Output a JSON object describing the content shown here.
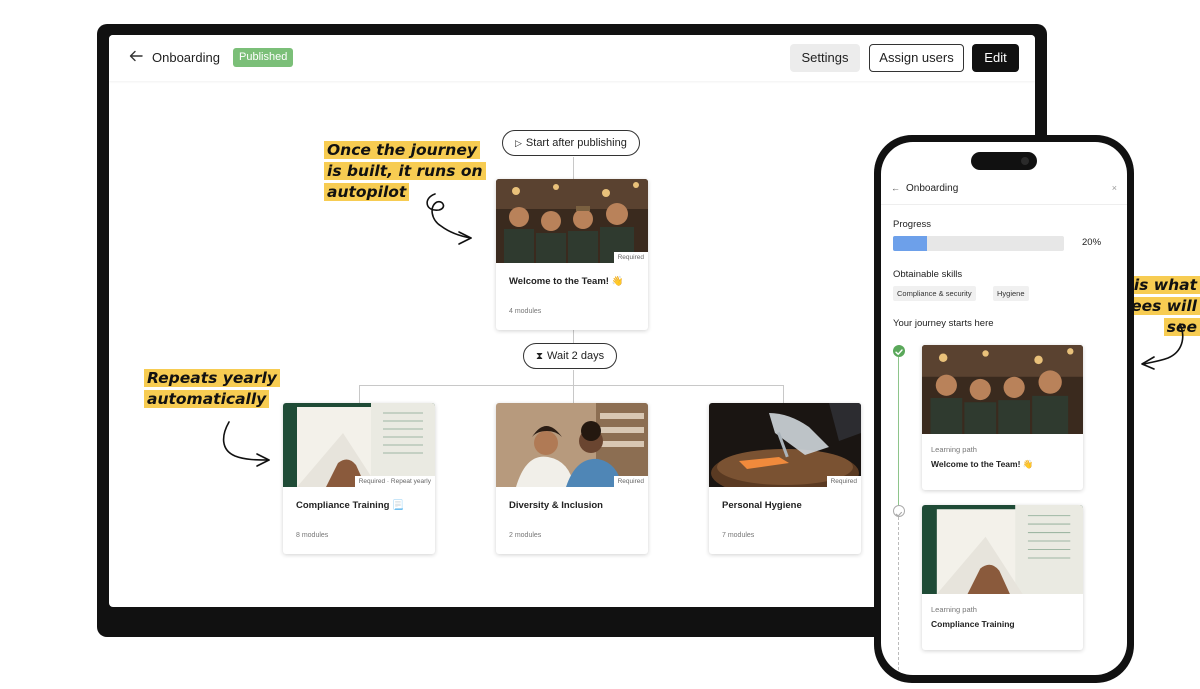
{
  "app": {
    "title": "Onboarding",
    "status_badge": "Published",
    "buttons": {
      "settings": "Settings",
      "assign": "Assign users",
      "edit": "Edit"
    }
  },
  "flow": {
    "start_label": "Start after publishing",
    "wait_label": "Wait 2 days",
    "main_card": {
      "tag": "Required",
      "title": "Welcome to the Team! 👋",
      "modules": "4 modules"
    },
    "cards": [
      {
        "tag": "Required · Repeat yearly",
        "title": "Compliance Training 📃",
        "modules": "8 modules"
      },
      {
        "tag": "Required",
        "title": "Diversity & Inclusion",
        "modules": "2 modules"
      },
      {
        "tag": "Required",
        "title": "Personal Hygiene",
        "modules": "7 modules"
      }
    ]
  },
  "annotations": {
    "autopilot": [
      "Once the journey",
      "is built, it runs on",
      "autopilot"
    ],
    "yearly": [
      "Repeats yearly",
      "automatically"
    ],
    "employees": [
      "This is what",
      "employees will see"
    ]
  },
  "phone": {
    "title": "Onboarding",
    "progress_label": "Progress",
    "progress_value": 0.2,
    "progress_text": "20%",
    "skills_label": "Obtainable skills",
    "skills": [
      "Compliance & security",
      "Hygiene"
    ],
    "journey_label": "Your journey starts here",
    "items": [
      {
        "kind": "Learning path",
        "title": "Welcome to the Team! 👋"
      },
      {
        "kind": "Learning path",
        "title": "Compliance Training"
      }
    ]
  },
  "colors": {
    "accent_yellow": "#f7cc52",
    "badge_green": "#7bbf78",
    "progress_blue": "#6da0ea",
    "done_green": "#5aa85a"
  }
}
